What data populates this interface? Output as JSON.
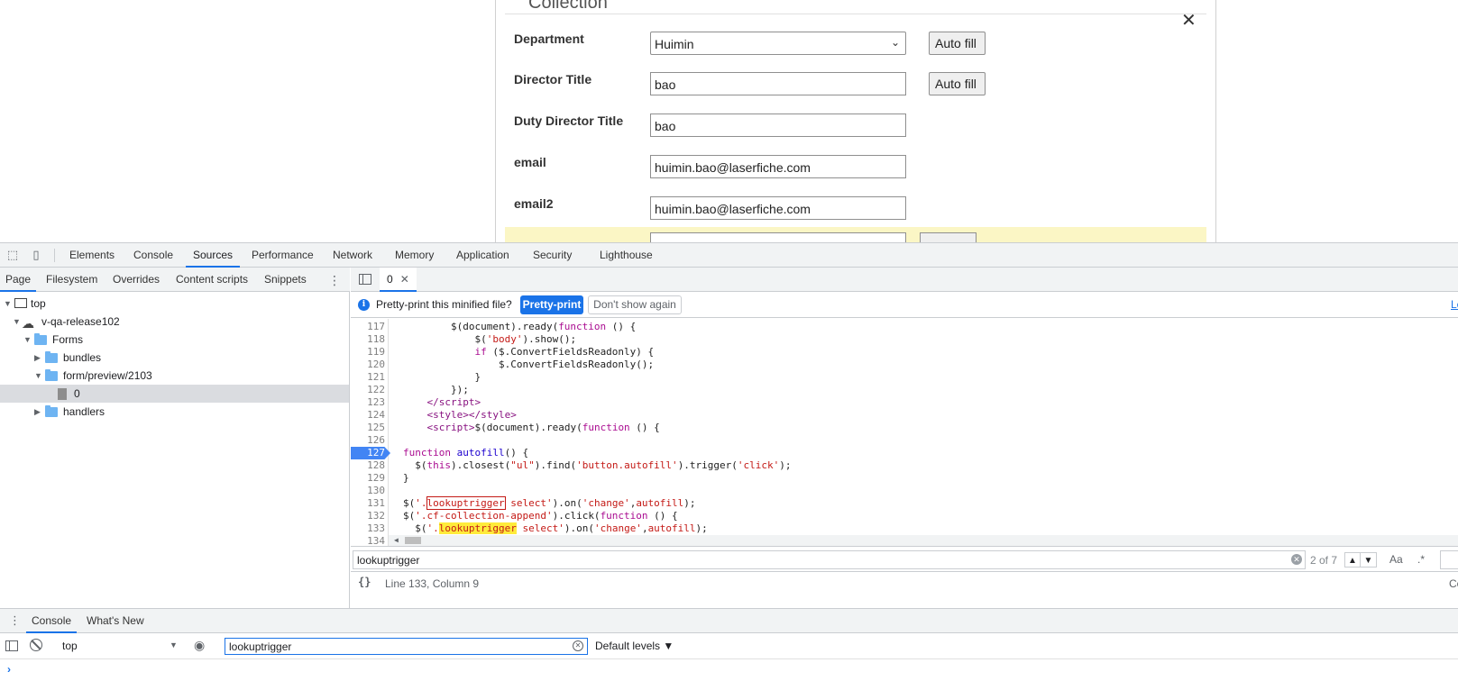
{
  "form": {
    "section_title": "Collection",
    "fields": [
      {
        "label": "Department",
        "value": "Huimin",
        "type": "select",
        "button": "Auto fill"
      },
      {
        "label": "Director Title",
        "value": "bao",
        "type": "text",
        "button": "Auto fill"
      },
      {
        "label": "Duty Director Title",
        "value": "bao",
        "type": "text"
      },
      {
        "label": "email",
        "value": "huimin.bao@laserfiche.com",
        "type": "text"
      },
      {
        "label": "email2",
        "value": "huimin.bao@laserfiche.com",
        "type": "text"
      }
    ],
    "remove_icon": "close-icon",
    "highlight_color": "#fbf6c5"
  },
  "devtools": {
    "main_tabs": [
      "Elements",
      "Console",
      "Sources",
      "Performance",
      "Network",
      "Memory",
      "Application",
      "Security",
      "Lighthouse"
    ],
    "active_tab": "Sources",
    "nav_tabs": [
      "Page",
      "Filesystem",
      "Overrides",
      "Content scripts",
      "Snippets"
    ],
    "active_nav_tab": "Page",
    "tree": [
      {
        "label": "top",
        "kind": "frame",
        "depth": 0,
        "expanded": true
      },
      {
        "label": "v-qa-release102",
        "kind": "cloud",
        "depth": 1,
        "expanded": true
      },
      {
        "label": "Forms",
        "kind": "folder",
        "depth": 2,
        "expanded": true
      },
      {
        "label": "bundles",
        "kind": "folder",
        "depth": 3,
        "expanded": false
      },
      {
        "label": "form/preview/2103",
        "kind": "folder",
        "depth": 3,
        "expanded": true
      },
      {
        "label": "0",
        "kind": "file",
        "depth": 4,
        "selected": true
      },
      {
        "label": "handlers",
        "kind": "folder",
        "depth": 3,
        "expanded": false
      }
    ],
    "editor": {
      "file_tab": "0",
      "infobar_text": "Pretty-print this minified file?",
      "pretty_print_button": "Pretty-print",
      "dont_show_button": "Don't show again",
      "infobar_link": "Le",
      "breakpoint_line": 127,
      "search_query": "lookuptrigger",
      "search_count": "2 of 7",
      "match_case_label": "Aa",
      "regex_label": ".*",
      "cursor_position": "Line 133, Column 9",
      "format_icon": "{}",
      "coverage_label": "Co"
    },
    "drawer": {
      "tabs": [
        "Console",
        "What's New"
      ],
      "active_tab": "Console",
      "context": "top",
      "filter": "lookuptrigger",
      "levels": "Default levels ▼",
      "prompt": "›"
    }
  }
}
